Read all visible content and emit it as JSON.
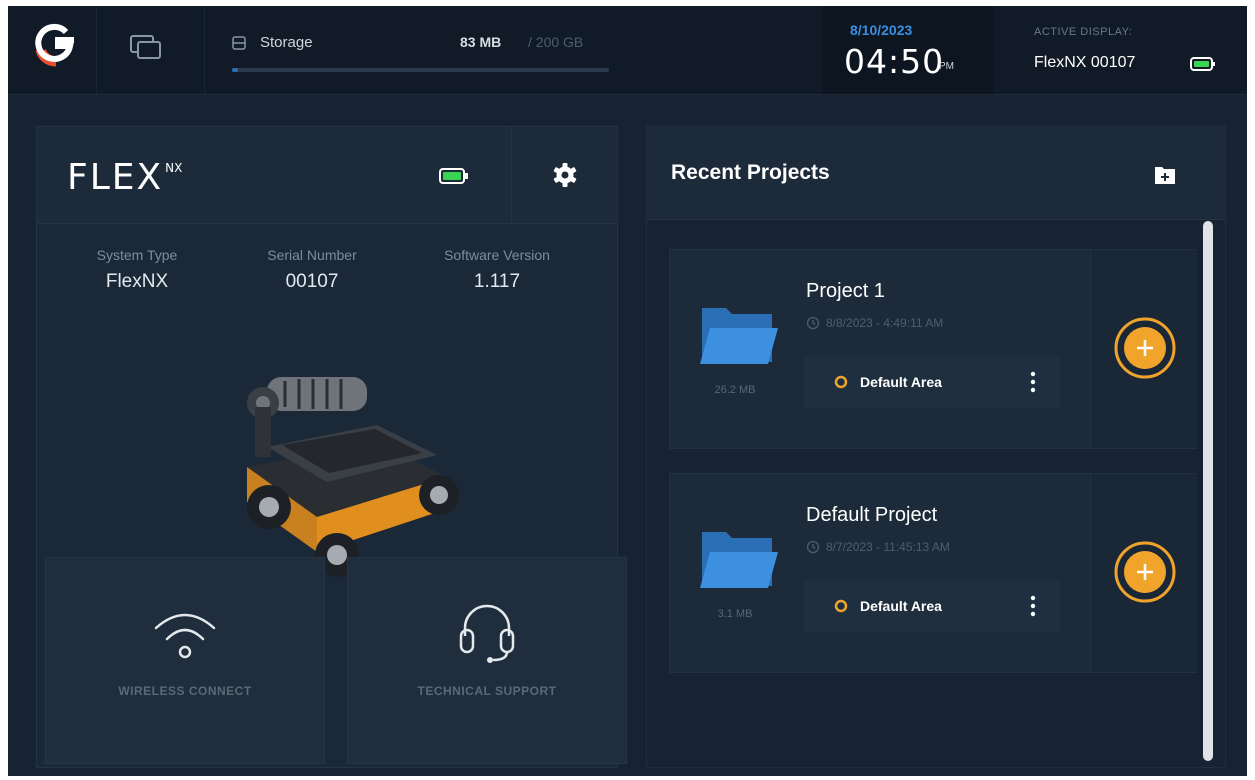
{
  "topbar": {
    "storage": {
      "label": "Storage",
      "used": "83 MB",
      "total": "/ 200 GB",
      "fraction_used": 0.0004
    },
    "date": "8/10/2023",
    "time": "04:50",
    "ampm": "PM",
    "active_display_label": "ACTIVE DISPLAY:",
    "active_display_value": "FlexNX 00107"
  },
  "device": {
    "brand": "FLEX",
    "brand_suffix": "NX",
    "info": [
      {
        "label": "System Type",
        "value": "FlexNX"
      },
      {
        "label": "Serial Number",
        "value": "00107"
      },
      {
        "label": "Software Version",
        "value": "1.117"
      }
    ],
    "tiles": [
      {
        "label": "WIRELESS CONNECT",
        "icon": "wifi-icon"
      },
      {
        "label": "TECHNICAL SUPPORT",
        "icon": "headset-icon"
      }
    ]
  },
  "projects": {
    "title": "Recent Projects",
    "items": [
      {
        "name": "Project 1",
        "date": "8/8/2023 - 4:49:11 AM",
        "size": "26.2 MB",
        "area": "Default Area"
      },
      {
        "name": "Default Project",
        "date": "8/7/2023 - 11:45:13 AM",
        "size": "3.1 MB",
        "area": "Default Area"
      }
    ]
  },
  "colors": {
    "background": "#172332",
    "accent_blue": "#3e8ee0",
    "accent_orange": "#f0a42c",
    "battery_green": "#39d353"
  },
  "icons": [
    "logo-icon",
    "displays-icon",
    "storage-icon",
    "battery-icon",
    "gear-icon",
    "new-folder-icon",
    "folder-icon",
    "clock-icon",
    "area-icon",
    "more-icon",
    "add-icon",
    "wifi-icon",
    "headset-icon"
  ]
}
